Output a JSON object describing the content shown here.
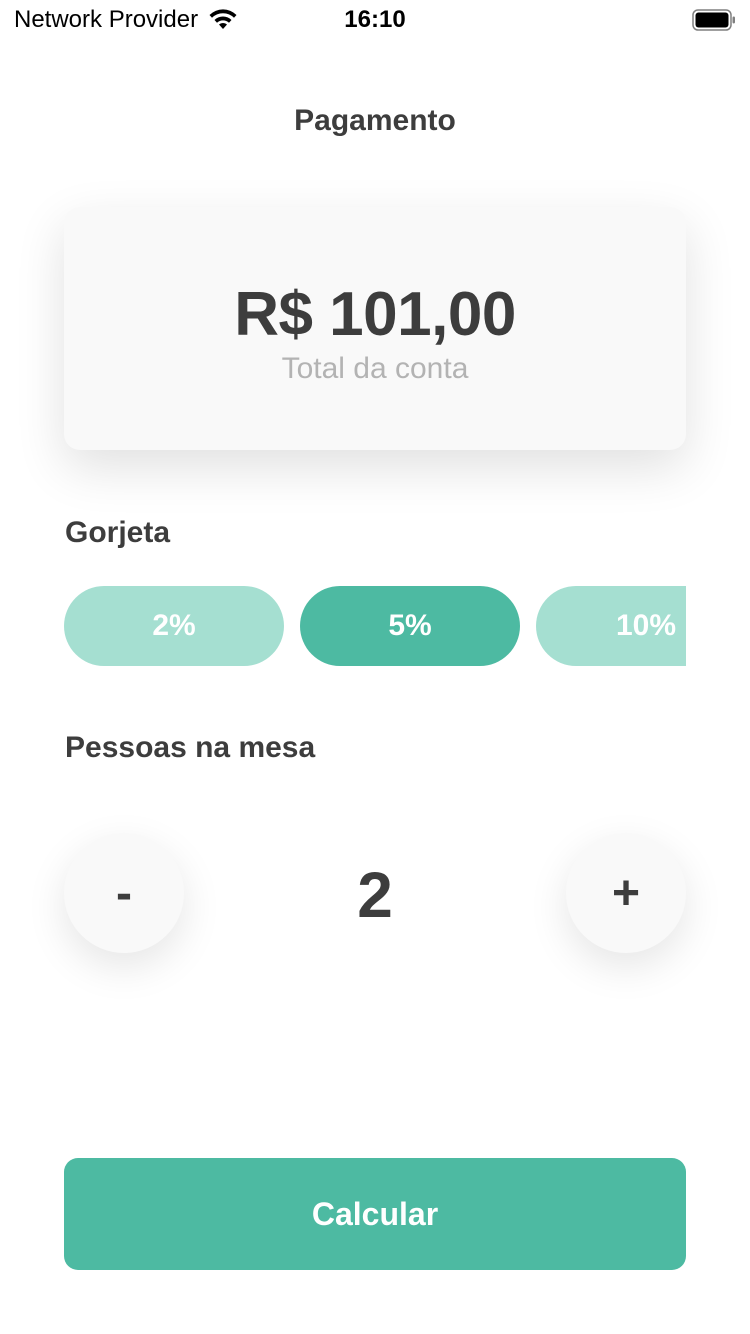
{
  "status_bar": {
    "carrier": "Network Provider",
    "time": "16:10",
    "wifi_icon": "wifi-icon",
    "battery_icon": "battery-icon"
  },
  "header": {
    "title": "Pagamento"
  },
  "bill": {
    "amount": "R$ 101,00",
    "label": "Total da conta"
  },
  "tip": {
    "label": "Gorjeta",
    "options": [
      "2%",
      "5%",
      "10%"
    ],
    "selected": "5%"
  },
  "people": {
    "label": "Pessoas na mesa",
    "minus_label": "-",
    "plus_label": "+",
    "count": "2"
  },
  "actions": {
    "calculate_label": "Calcular"
  },
  "colors": {
    "accent": "#4dbaa2",
    "accent_light": "#a5dfd1",
    "text": "#3d3d3d",
    "muted": "#b3b3b3"
  }
}
